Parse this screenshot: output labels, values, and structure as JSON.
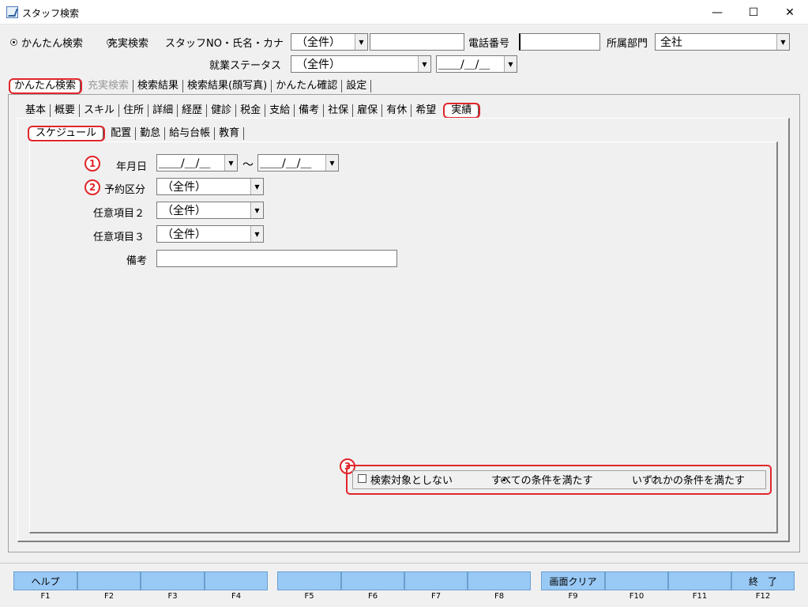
{
  "window": {
    "title": "スタッフ検索",
    "minimize": "—",
    "maximize": "☐",
    "close": "✕"
  },
  "top": {
    "mode_simple": "かんたん検索",
    "mode_full": "充実検索",
    "staff_label": "スタッフNO・氏名・カナ",
    "staff_select": "（全件）",
    "staff_text": "",
    "phone_label": "電話番号",
    "phone_value": "",
    "dept_label": "所属部門",
    "dept_value": "全社",
    "status_label": "就業ステータス",
    "status_value": "（全件）",
    "status_date": "＿＿/＿/＿"
  },
  "main_tabs": [
    "かんたん検索",
    "充実検索",
    "検索結果",
    "検索結果(顔写真)",
    "かんたん確認",
    "設定"
  ],
  "sub_tabs": [
    "基本",
    "概要",
    "スキル",
    "住所",
    "詳細",
    "経歴",
    "健診",
    "税金",
    "支給",
    "備考",
    "社保",
    "雇保",
    "有休",
    "希望",
    "実績"
  ],
  "inner_tabs": [
    "スケジュール",
    "配置",
    "勤怠",
    "給与台帳",
    "教育"
  ],
  "form": {
    "badge1": "1",
    "badge2": "2",
    "badge3": "3",
    "date_label": "年月日",
    "date_from": "＿＿/＿/＿",
    "tilde": "〜",
    "date_to": "＿＿/＿/＿",
    "booking_label": "予約区分",
    "booking_value": "（全件）",
    "opt2_label": "任意項目２",
    "opt2_value": "（全件）",
    "opt3_label": "任意項目３",
    "opt3_value": "（全件）",
    "memo_label": "備考",
    "memo_value": ""
  },
  "conditions": {
    "exclude": "検索対象としない",
    "all": "すべての条件を満たす",
    "any": "いずれかの条件を満たす"
  },
  "fkeys": [
    {
      "label": "ヘルプ",
      "key": "F1"
    },
    {
      "label": "",
      "key": "F2"
    },
    {
      "label": "",
      "key": "F3"
    },
    {
      "label": "",
      "key": "F4"
    },
    {
      "label": "",
      "key": "F5"
    },
    {
      "label": "",
      "key": "F6"
    },
    {
      "label": "",
      "key": "F7"
    },
    {
      "label": "",
      "key": "F8"
    },
    {
      "label": "画面クリア",
      "key": "F9"
    },
    {
      "label": "",
      "key": "F10"
    },
    {
      "label": "",
      "key": "F11"
    },
    {
      "label": "終　了",
      "key": "F12"
    }
  ],
  "icons": {
    "dropdown": "▼"
  },
  "colors": {
    "highlight": "#e0262b",
    "fkey": "#99c9f5"
  }
}
